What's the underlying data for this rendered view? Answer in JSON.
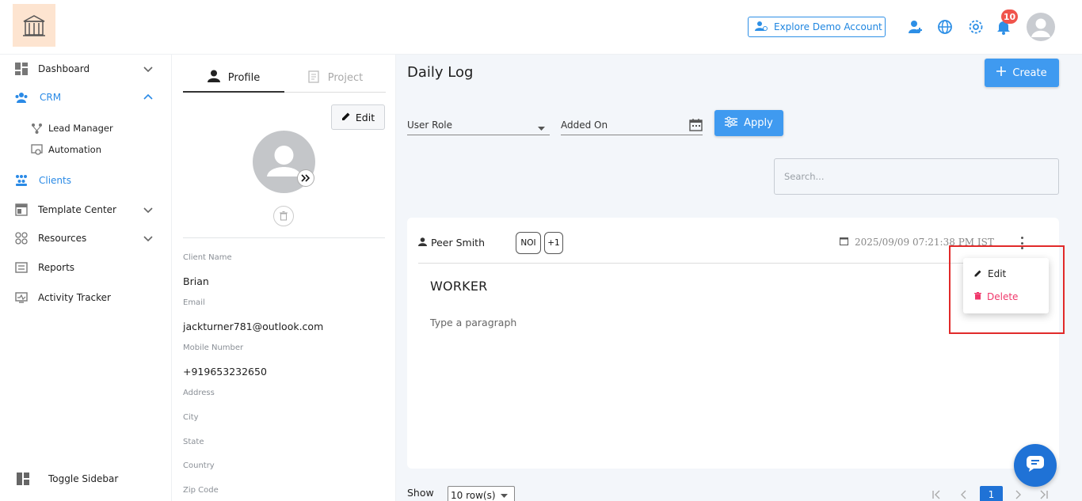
{
  "header": {
    "demo_button": "Explore Demo Account",
    "notification_count": "10",
    "icons": [
      "add-user-icon",
      "globe-icon",
      "gear-icon",
      "bell-icon",
      "user-avatar"
    ]
  },
  "sidebar": {
    "items": [
      {
        "label": "Dashboard",
        "icon": "dashboard-icon",
        "expandable": true
      },
      {
        "label": "CRM",
        "icon": "crm-icon",
        "expandable": true,
        "expanded": true,
        "active": true
      },
      {
        "label": "Lead Manager",
        "icon": "lead-manager-icon",
        "sub": true
      },
      {
        "label": "Automation",
        "icon": "automation-icon",
        "sub": true
      },
      {
        "label": "Clients",
        "icon": "clients-icon",
        "active": true
      },
      {
        "label": "Template Center",
        "icon": "template-icon",
        "expandable": true
      },
      {
        "label": "Resources",
        "icon": "resources-icon",
        "expandable": true
      },
      {
        "label": "Reports",
        "icon": "reports-icon"
      },
      {
        "label": "Activity Tracker",
        "icon": "activity-icon"
      }
    ],
    "toggle_label": "Toggle Sidebar"
  },
  "profile": {
    "tabs": {
      "profile": "Profile",
      "project": "Project"
    },
    "edit_label": "Edit",
    "fields": {
      "client_name_label": "Client Name",
      "client_name": "Brian",
      "email_label": "Email",
      "email": "jackturner781@outlook.com",
      "mobile_label": "Mobile Number",
      "mobile": "+919653232650",
      "address_label": "Address",
      "city_label": "City",
      "state_label": "State",
      "country_label": "Country",
      "zip_label": "Zip Code"
    }
  },
  "main": {
    "title": "Daily Log",
    "create_label": "Create",
    "filters": {
      "user_role": "User Role",
      "added_on": "Added On",
      "apply": "Apply"
    },
    "search_placeholder": "Search...",
    "log": {
      "user": "Peer Smith",
      "chips": [
        "NOI",
        "+1"
      ],
      "date": "2025/09/09 07:21:38 PM IST",
      "title": "WORKER",
      "body": "Type a paragraph"
    },
    "menu": {
      "edit": "Edit",
      "delete": "Delete"
    },
    "pagination": {
      "show_label": "Show",
      "rows": "10 row(s)",
      "current_page": "1"
    }
  },
  "colors": {
    "accent": "#3f9af0",
    "danger": "#f0386b",
    "highlight": "#e12a2a",
    "page_active": "#1f72d6"
  }
}
